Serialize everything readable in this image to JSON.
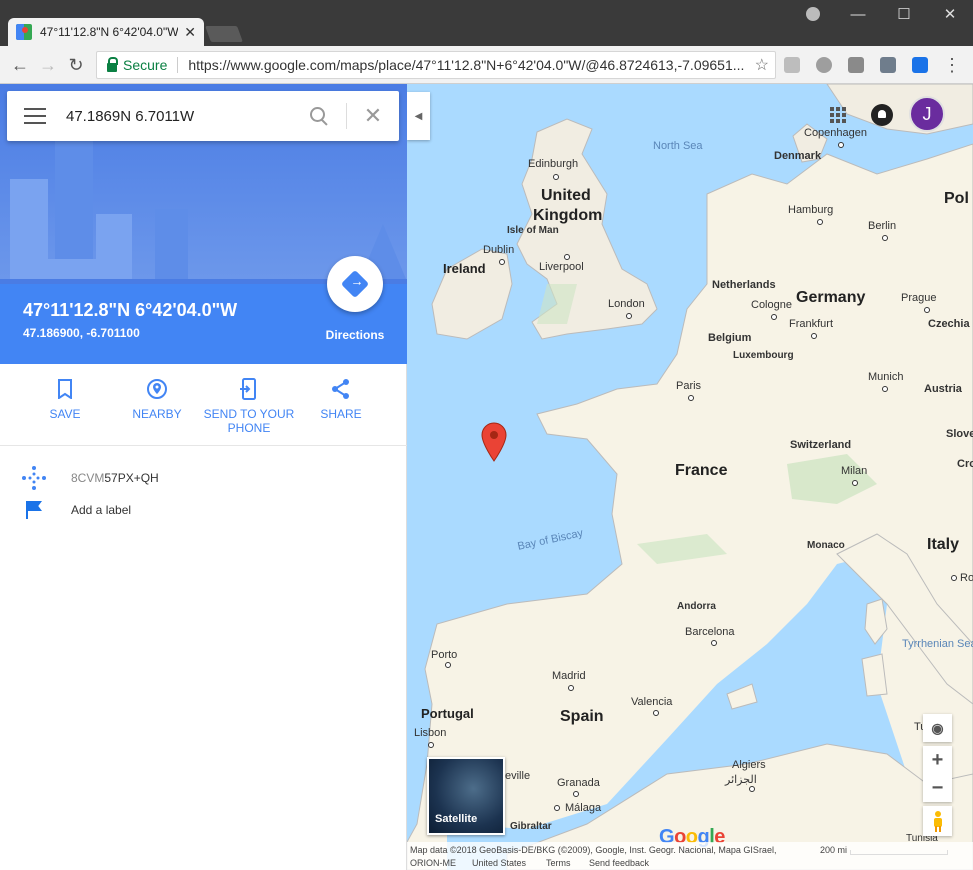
{
  "browser": {
    "tab_title": "47°11'12.8\"N 6°42'04.0\"W",
    "secure_label": "Secure",
    "url": "https://www.google.com/maps/place/47°11'12.8\"N+6°42'04.0\"W/@46.8724613,-7.09651...",
    "icons": [
      "back-icon",
      "forward-icon",
      "reload-icon",
      "star-icon",
      "window-minimize-icon",
      "window-maximize-icon",
      "window-close-icon"
    ]
  },
  "search": {
    "value": "47.1869N 6.7011W"
  },
  "place": {
    "title": "47°11'12.8\"N 6°42'04.0\"W",
    "coords": "47.186900, -6.701100",
    "directions_label": "Directions"
  },
  "actions": [
    {
      "line1": "SAVE",
      "line2": ""
    },
    {
      "line1": "NEARBY",
      "line2": ""
    },
    {
      "line1": "SEND TO YOUR",
      "line2": "PHONE"
    },
    {
      "line1": "SHARE",
      "line2": ""
    }
  ],
  "plus_code": {
    "prefix": "8CVM",
    "code": "57PX+QH"
  },
  "add_label": "Add a label",
  "map": {
    "countries": [
      "United Kingdom",
      "Ireland",
      "Germany",
      "France",
      "Spain",
      "Portugal",
      "Italy",
      "Netherlands",
      "Belgium",
      "Luxembourg",
      "Switzerland",
      "Austria",
      "Czechia",
      "Denmark",
      "Andorra",
      "Monaco",
      "Pol"
    ],
    "united": "United",
    "kingdom": "Kingdom",
    "seas": {
      "north_sea": "North Sea",
      "biscay": "Bay of Biscay",
      "tyrrhenian": "Tyrrhenian Sea",
      "isle_of_man": "Isle of Man"
    },
    "cities": {
      "copenhagen": "Copenhagen",
      "edinburgh": "Edinburgh",
      "hamburg": "Hamburg",
      "berlin": "Berlin",
      "dublin": "Dublin",
      "liverpool": "Liverpool",
      "london": "London",
      "cologne": "Cologne",
      "prague": "Prague",
      "frankfurt": "Frankfurt",
      "paris": "Paris",
      "munich": "Munich",
      "slove": "Slove",
      "cro": "Cro",
      "milan": "Milan",
      "rome": "Rom",
      "porto": "Porto",
      "madrid": "Madrid",
      "valencia": "Valencia",
      "barcelona": "Barcelona",
      "lisbon": "Lisbon",
      "seville": "eville",
      "granada": "Granada",
      "malaga": "Málaga",
      "gibraltar": "Gibraltar",
      "algiers": "Algiers",
      "algiers_ar": "الجزائر",
      "tunisia": "Tunisia",
      "tunis": "Tu"
    },
    "satellite_label": "Satellite",
    "avatar_letter": "J",
    "zoom_in": "+",
    "zoom_out": "−",
    "google": [
      "G",
      "o",
      "o",
      "g",
      "l",
      "e"
    ],
    "colors": {
      "g_blue": "#4285f4",
      "g_red": "#ea4335",
      "g_yellow": "#fbbc05",
      "g_green": "#34a853"
    },
    "footer": {
      "map_data": "Map data ©2018 GeoBasis-DE/BKG (©2009), Google, Inst. Geogr. Nacional, Mapa GISrael,",
      "orion": "ORION-ME",
      "region": "United States",
      "terms": "Terms",
      "feedback": "Send feedback",
      "scale": "200 mi"
    }
  }
}
